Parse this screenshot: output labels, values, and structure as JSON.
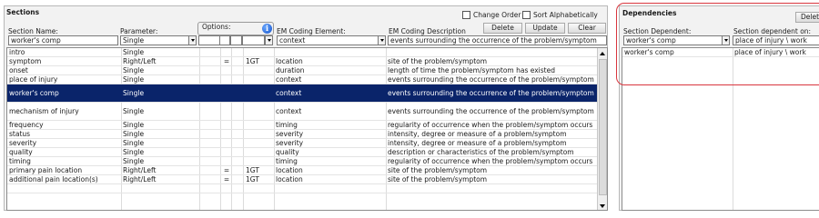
{
  "sections": {
    "title": "Sections",
    "change_order_label": "Change Order",
    "sort_alpha_label": "Sort Alphabetically",
    "options_label": "Options:",
    "headers": {
      "section_name": "Section Name:",
      "parameter": "Parameter:",
      "em_element": "EM Coding Element:",
      "em_description": "EM Coding Description"
    },
    "buttons": {
      "delete": "Delete",
      "update": "Update",
      "clear": "Clear"
    },
    "inputs": {
      "section_name": "worker's comp",
      "parameter": "Single",
      "em_element": "context",
      "em_description": "events surrounding the occurrence of the problem/symptom"
    },
    "rows": [
      {
        "name": "intro",
        "param": "Single",
        "o1": "",
        "o2": "",
        "o3": "",
        "em": "",
        "desc": ""
      },
      {
        "name": "symptom",
        "param": "Right/Left",
        "o1": "",
        "o2": "=",
        "o3": "1GT",
        "em": "location",
        "desc": "site of the problem/symptom"
      },
      {
        "name": "onset",
        "param": "Single",
        "o1": "",
        "o2": "",
        "o3": "",
        "em": "duration",
        "desc": "length of time the problem/symptom has existed"
      },
      {
        "name": "place of injury",
        "param": "Single",
        "o1": "",
        "o2": "",
        "o3": "",
        "em": "context",
        "desc": "events surrounding the occurrence of the problem/symptom"
      },
      {
        "name": "worker's comp",
        "param": "Single",
        "o1": "",
        "o2": "",
        "o3": "",
        "em": "context",
        "desc": "events surrounding the occurrence of the problem/symptom"
      },
      {
        "name": "mechanism of injury",
        "param": "Single",
        "o1": "",
        "o2": "",
        "o3": "",
        "em": "context",
        "desc": "events surrounding the occurrence of the problem/symptom"
      },
      {
        "name": "frequency",
        "param": "Single",
        "o1": "",
        "o2": "",
        "o3": "",
        "em": "timing",
        "desc": "regularity of occurrence when the problem/symptom occurs"
      },
      {
        "name": "status",
        "param": "Single",
        "o1": "",
        "o2": "",
        "o3": "",
        "em": "severity",
        "desc": "intensity, degree or measure of a problem/symptom"
      },
      {
        "name": "severity",
        "param": "Single",
        "o1": "",
        "o2": "",
        "o3": "",
        "em": "severity",
        "desc": "intensity, degree or measure of a problem/symptom"
      },
      {
        "name": "quality",
        "param": "Single",
        "o1": "",
        "o2": "",
        "o3": "",
        "em": "quality",
        "desc": "description or characteristics of the problem/symptom"
      },
      {
        "name": "timing",
        "param": "Single",
        "o1": "",
        "o2": "",
        "o3": "",
        "em": "timing",
        "desc": "regularity of occurrence when the problem/symptom occurs"
      },
      {
        "name": "primary pain location",
        "param": "Right/Left",
        "o1": "",
        "o2": "=",
        "o3": "1GT",
        "em": "location",
        "desc": "site of the problem/symptom"
      },
      {
        "name": "additional pain location(s)",
        "param": "Right/Left",
        "o1": "",
        "o2": "=",
        "o3": "1GT",
        "em": "location",
        "desc": "site of the problem/symptom"
      },
      {
        "name": "",
        "param": "",
        "o1": "",
        "o2": "",
        "o3": "",
        "em": "",
        "desc": ""
      }
    ],
    "selected_index": 4
  },
  "dependencies": {
    "title": "Dependencies",
    "delete_label": "Delet",
    "headers": {
      "dependent": "Section Dependent:",
      "dependent_on": "Section dependent on:"
    },
    "inputs": {
      "dependent": "worker's comp",
      "dependent_on": "place of injury \\ work"
    },
    "rows": [
      {
        "dependent": "worker's comp",
        "dependent_on": "place of injury \\ work"
      }
    ]
  },
  "colors": {
    "selection": "#0a246a",
    "highlight_border": "#d9363e"
  }
}
